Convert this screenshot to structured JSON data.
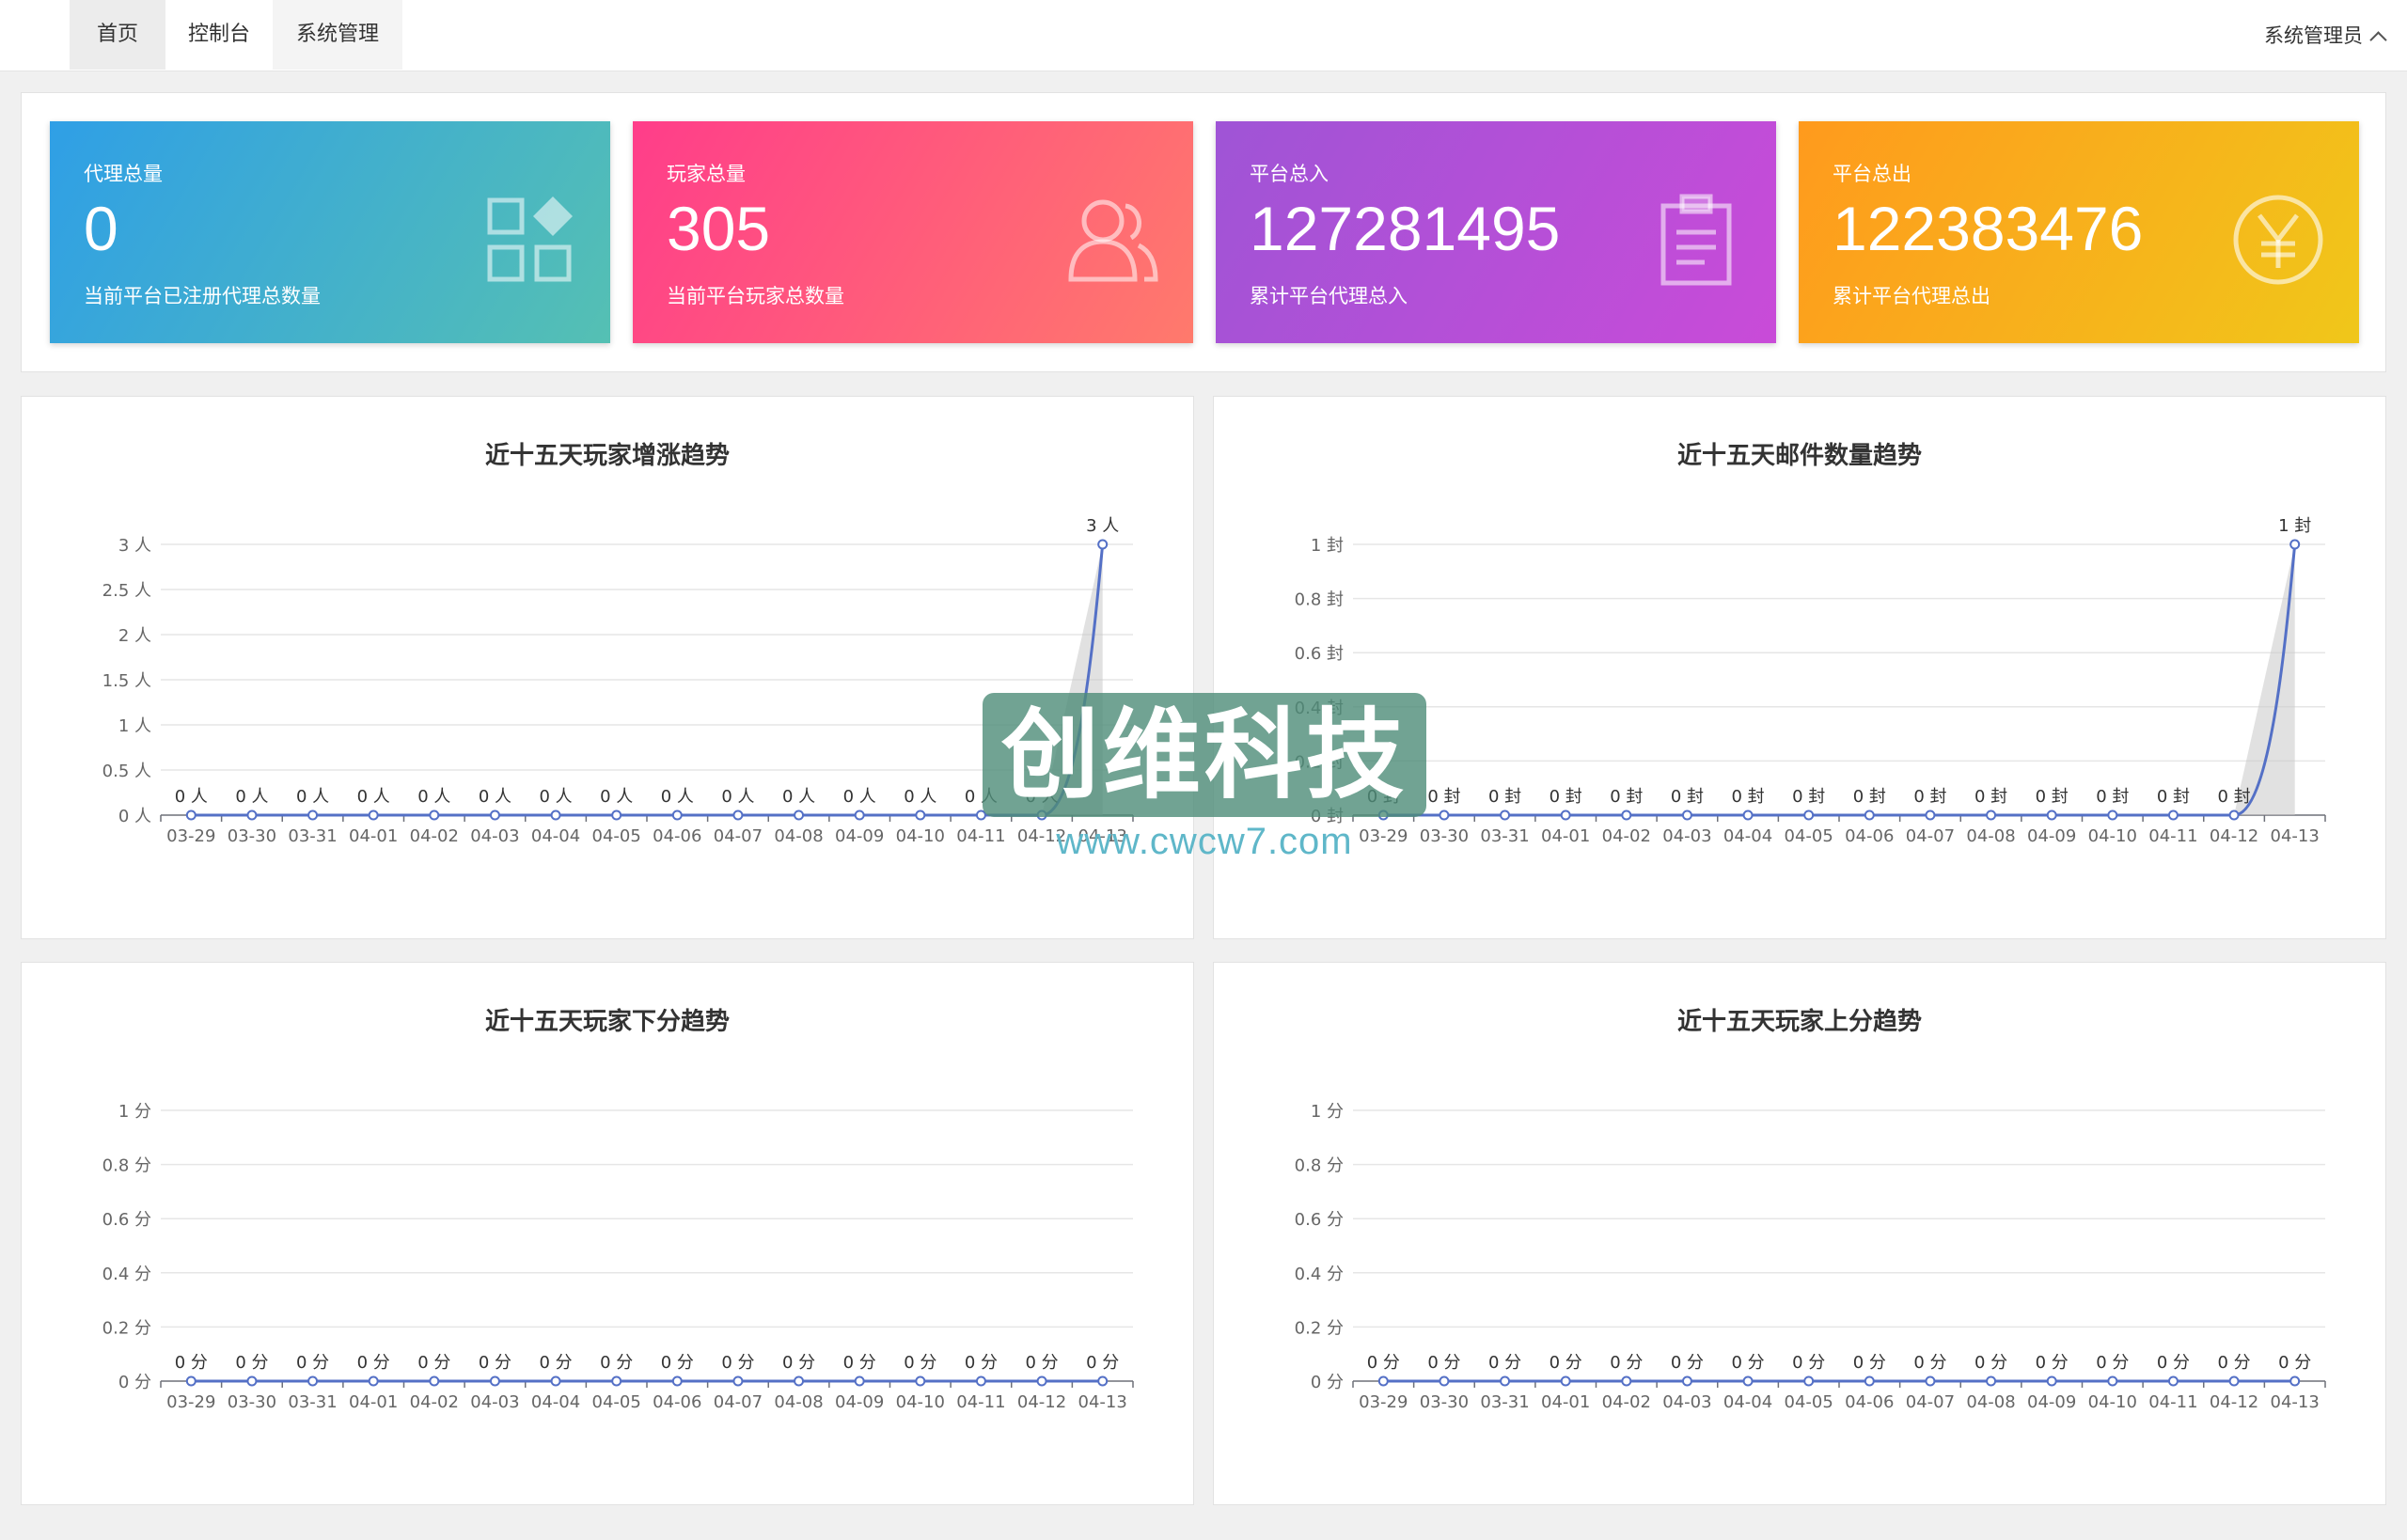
{
  "nav": {
    "tabs": [
      {
        "label": "首页"
      },
      {
        "label": "控制台"
      },
      {
        "label": "系统管理"
      }
    ],
    "user_label": "系统管理员"
  },
  "stats": [
    {
      "label": "代理总量",
      "value": "0",
      "sub": "当前平台已注册代理总数量",
      "icon": "grid-shapes-icon",
      "gradient": [
        "#2f9fe6",
        "#55c0b3"
      ]
    },
    {
      "label": "玩家总量",
      "value": "305",
      "sub": "当前平台玩家总数量",
      "icon": "users-icon",
      "gradient": [
        "#ff3d8a",
        "#ff7a6c"
      ]
    },
    {
      "label": "平台总入",
      "value": "127281495",
      "sub": "累计平台代理总入",
      "icon": "clipboard-icon",
      "gradient": [
        "#9f54d6",
        "#c94bd8"
      ]
    },
    {
      "label": "平台总出",
      "value": "122383476",
      "sub": "累计平台代理总出",
      "icon": "yen-icon",
      "gradient": [
        "#ff9a1d",
        "#f0c71a"
      ]
    }
  ],
  "chart_data": [
    {
      "type": "line",
      "title": "近十五天玩家增涨趋势",
      "unit": "人",
      "x": [
        "03-29",
        "03-30",
        "03-31",
        "04-01",
        "04-02",
        "04-03",
        "04-04",
        "04-05",
        "04-06",
        "04-07",
        "04-08",
        "04-09",
        "04-10",
        "04-11",
        "04-12",
        "04-13"
      ],
      "values": [
        0,
        0,
        0,
        0,
        0,
        0,
        0,
        0,
        0,
        0,
        0,
        0,
        0,
        0,
        0,
        3
      ],
      "y_ticks": [
        "0 人",
        "0.5 人",
        "1 人",
        "1.5 人",
        "2 人",
        "2.5 人",
        "3 人"
      ],
      "ylim": [
        0,
        3
      ],
      "point_labels": [
        "0 人",
        "0 人",
        "0 人",
        "0 人",
        "0 人",
        "0 人",
        "0 人",
        "0 人",
        "0 人",
        "0 人",
        "0 人",
        "0 人",
        "0 人",
        "0 人",
        "0 人",
        "3 人"
      ],
      "grid": true
    },
    {
      "type": "line",
      "title": "近十五天邮件数量趋势",
      "unit": "封",
      "x": [
        "03-29",
        "03-30",
        "03-31",
        "04-01",
        "04-02",
        "04-03",
        "04-04",
        "04-05",
        "04-06",
        "04-07",
        "04-08",
        "04-09",
        "04-10",
        "04-11",
        "04-12",
        "04-13"
      ],
      "values": [
        0,
        0,
        0,
        0,
        0,
        0,
        0,
        0,
        0,
        0,
        0,
        0,
        0,
        0,
        0,
        1
      ],
      "y_ticks": [
        "0 封",
        "0.2 封",
        "0.4 封",
        "0.6 封",
        "0.8 封",
        "1 封"
      ],
      "ylim": [
        0,
        1
      ],
      "point_labels": [
        "0 封",
        "0 封",
        "0 封",
        "0 封",
        "0 封",
        "0 封",
        "0 封",
        "0 封",
        "0 封",
        "0 封",
        "0 封",
        "0 封",
        "0 封",
        "0 封",
        "0 封",
        "1 封"
      ],
      "grid": true
    },
    {
      "type": "line",
      "title": "近十五天玩家下分趋势",
      "unit": "分",
      "x": [
        "03-29",
        "03-30",
        "03-31",
        "04-01",
        "04-02",
        "04-03",
        "04-04",
        "04-05",
        "04-06",
        "04-07",
        "04-08",
        "04-09",
        "04-10",
        "04-11",
        "04-12",
        "04-13"
      ],
      "values": [
        0,
        0,
        0,
        0,
        0,
        0,
        0,
        0,
        0,
        0,
        0,
        0,
        0,
        0,
        0,
        0
      ],
      "y_ticks": [
        "0 分",
        "0.2 分",
        "0.4 分",
        "0.6 分",
        "0.8 分",
        "1 分"
      ],
      "ylim": [
        0,
        1
      ],
      "point_labels": [
        "0 分",
        "0 分",
        "0 分",
        "0 分",
        "0 分",
        "0 分",
        "0 分",
        "0 分",
        "0 分",
        "0 分",
        "0 分",
        "0 分",
        "0 分",
        "0 分",
        "0 分",
        "0 分"
      ],
      "grid": true
    },
    {
      "type": "line",
      "title": "近十五天玩家上分趋势",
      "unit": "分",
      "x": [
        "03-29",
        "03-30",
        "03-31",
        "04-01",
        "04-02",
        "04-03",
        "04-04",
        "04-05",
        "04-06",
        "04-07",
        "04-08",
        "04-09",
        "04-10",
        "04-11",
        "04-12",
        "04-13"
      ],
      "values": [
        0,
        0,
        0,
        0,
        0,
        0,
        0,
        0,
        0,
        0,
        0,
        0,
        0,
        0,
        0,
        0
      ],
      "y_ticks": [
        "0 分",
        "0.2 分",
        "0.4 分",
        "0.6 分",
        "0.8 分",
        "1 分"
      ],
      "ylim": [
        0,
        1
      ],
      "point_labels": [
        "0 分",
        "0 分",
        "0 分",
        "0 分",
        "0 分",
        "0 分",
        "0 分",
        "0 分",
        "0 分",
        "0 分",
        "0 分",
        "0 分",
        "0 分",
        "0 分",
        "0 分",
        "0 分"
      ],
      "grid": true
    }
  ],
  "watermark": {
    "text": "创维科技",
    "url": "www.cwcw7.com"
  },
  "colors": {
    "line": "#5470c6",
    "grid": "#e6e6e6",
    "axis_text": "#666666",
    "area": "#c8c8c8"
  }
}
